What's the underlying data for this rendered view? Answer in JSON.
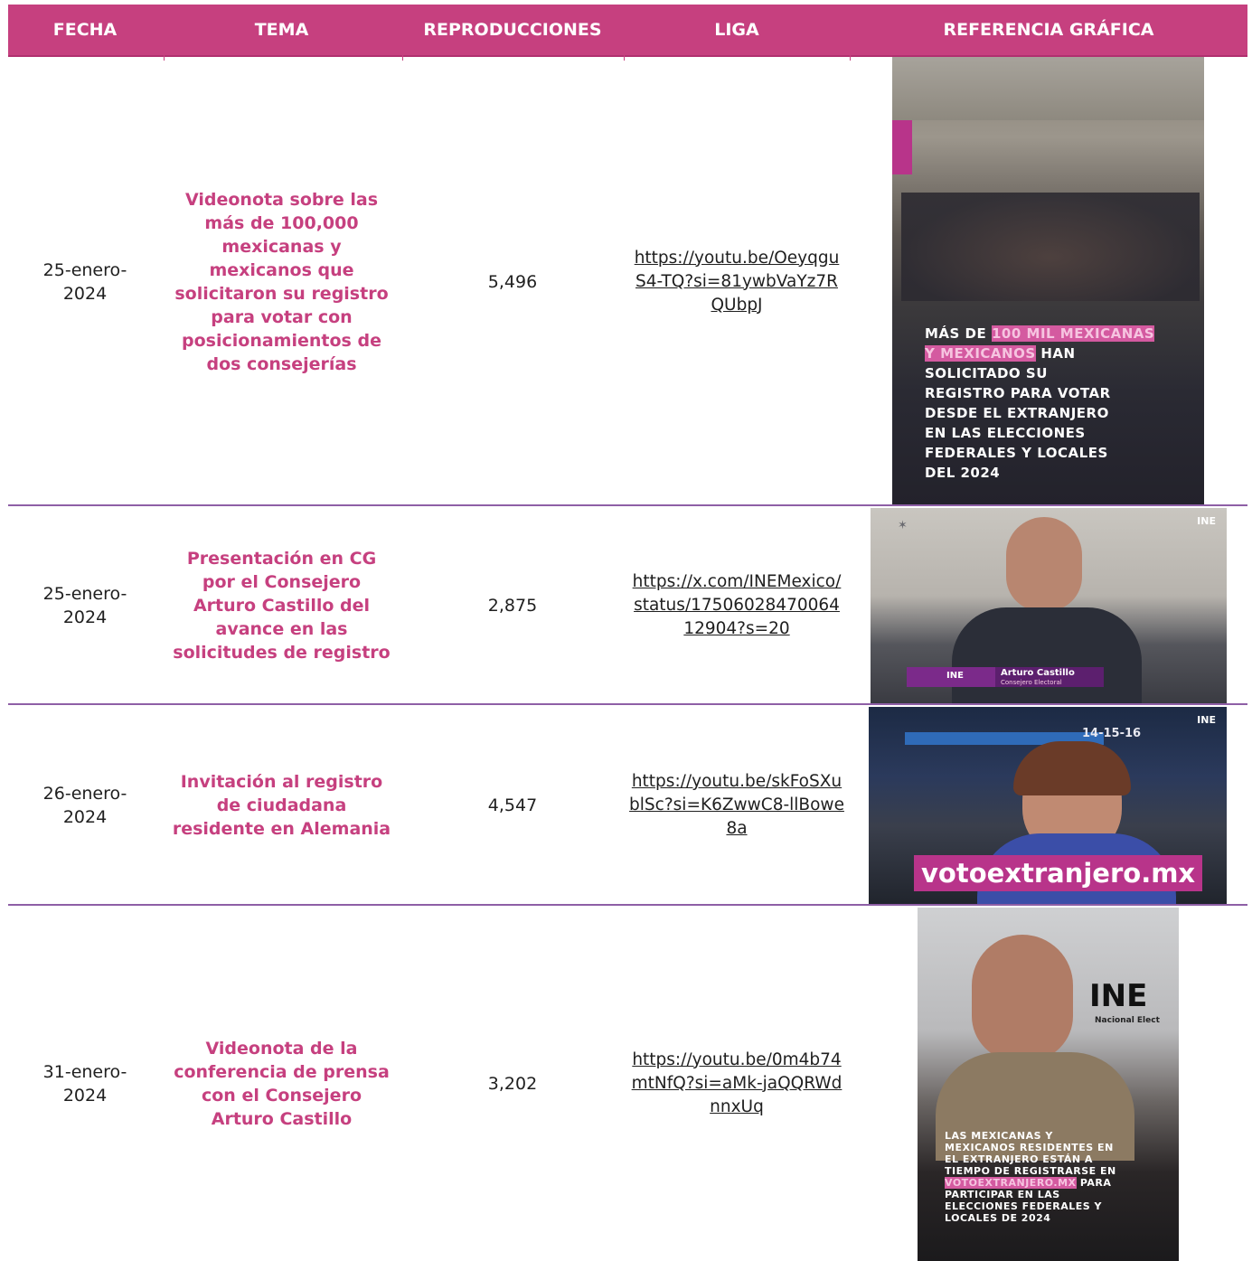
{
  "headers": {
    "fecha": "FECHA",
    "tema": "TEMA",
    "reproducciones": "REPRODUCCIONES",
    "liga": "LIGA",
    "referencia": "REFERENCIA GRÁFICA"
  },
  "rows": [
    {
      "fecha": "25-enero-\n2024",
      "tema": "Videonota sobre las más de 100,000 mexicanas y mexicanos que solicitaron su registro para votar con posicionamientos de dos consejerías",
      "reproducciones": "5,496",
      "liga": "https://youtu.be/OeyqguS4-TQ?si=81ywbVaYz7RQUbpJ",
      "image": {
        "line1_pre": "MÁS DE ",
        "line1_hl": "100 MIL MEXICANAS",
        "line2_hl": "Y MEXICANOS",
        "line2_post": " HAN",
        "rest": [
          "SOLICITADO SU",
          "REGISTRO PARA VOTAR",
          "DESDE EL EXTRANJERO",
          "EN LAS ELECCIONES",
          "FEDERALES Y LOCALES",
          "DEL 2024"
        ]
      }
    },
    {
      "fecha": "25-enero-\n2024",
      "tema": "Presentación en CG por el Consejero Arturo Castillo del avance en las solicitudes de registro",
      "reproducciones": "2,875",
      "liga": "https://x.com/INEMexico/status/1750602847006412904?s=20",
      "image": {
        "logo": "INE",
        "name": "Arturo Castillo",
        "caption": "Consejero Electoral"
      }
    },
    {
      "fecha": "26-enero-\n2024",
      "tema": "Invitación al registro de ciudadana residente en Alemania",
      "reproducciones": "4,547",
      "liga": "https://youtu.be/skFoSXublSc?si=K6ZwwC8-llBowe8a",
      "image": {
        "banner": "votoextranjero.mx",
        "logo": "INE",
        "platform": "14-15-16"
      }
    },
    {
      "fecha": "31-enero-\n2024",
      "tema": "Videonota de la conferencia de prensa con el Consejero Arturo Castillo",
      "reproducciones": "3,202",
      "liga": "https://youtu.be/0m4b74mtNfQ?si=aMk-jaQQRWdnnxUq",
      "image": {
        "logo": "INE",
        "sublogo": "Nacional Elect",
        "lines_pre": [
          "LAS MEXICANAS Y",
          "MEXICANOS RESIDENTES EN",
          "EL EXTRANJERO ESTÁN A",
          "TIEMPO DE REGISTRARSE EN"
        ],
        "hl": "VOTOEXTRANJERO.MX",
        "hl_post": " PARA",
        "lines_post": [
          "PARTICIPAR EN LAS",
          "ELECCIONES FEDERALES Y",
          "LOCALES DE 2024"
        ]
      }
    }
  ],
  "colors": {
    "accent": "#c6407f",
    "separator": "#8e5fa6"
  }
}
